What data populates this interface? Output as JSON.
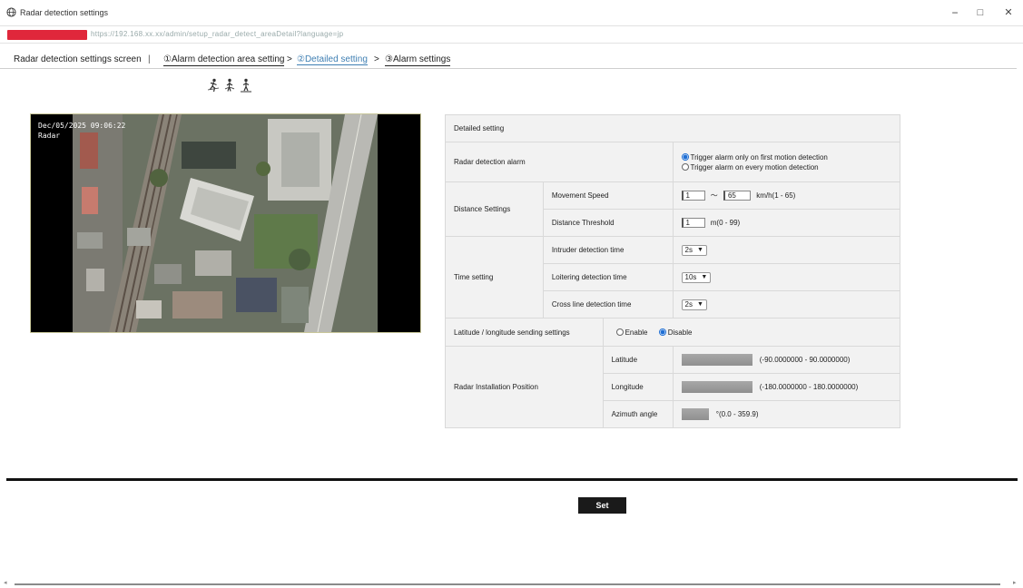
{
  "window": {
    "title": "Radar detection settings",
    "controls": {
      "minimize": "−",
      "maximize": "□",
      "close": "✕"
    }
  },
  "address": {
    "url": "https://192.168.xx.xx/admin/setup_radar_detect_areaDetail?language=jp"
  },
  "nav": {
    "screen_label": "Radar detection settings screen",
    "separator": "|",
    "step1": "①Alarm detection area setting",
    "arrow1": ">",
    "step2": "②Detailed setting",
    "arrow2": ">",
    "step3": "③Alarm settings"
  },
  "camera": {
    "datetime": "Dec/05/2025 09:06:22",
    "label": "Radar"
  },
  "detail": {
    "header": "Detailed setting",
    "radar_alarm": {
      "label": "Radar detection alarm",
      "opt1": "Trigger alarm only on first motion detection",
      "opt2": "Trigger alarm on every motion detection",
      "selected": 1
    },
    "distance": {
      "label": "Distance Settings",
      "speed_label": "Movement Speed",
      "speed_min": "1",
      "tilde": "～",
      "speed_max": "65",
      "speed_unit": "km/h(1 - 65)",
      "threshold_label": "Distance Threshold",
      "threshold": "1",
      "threshold_unit": "m(0 - 99)"
    },
    "time": {
      "label": "Time setting",
      "intruder_label": "Intruder detection time",
      "intruder": "2s",
      "loitering_label": "Loitering detection time",
      "loitering": "10s",
      "cross_label": "Cross line detection time",
      "cross": "2s"
    },
    "latlon_send": {
      "label": "Latitude / longitude sending settings",
      "enable": "Enable",
      "disable": "Disable",
      "selected": "Disable"
    },
    "position": {
      "label": "Radar Installation Position",
      "lat_label": "Latitude",
      "lat_range": "(-90.0000000 - 90.0000000)",
      "lon_label": "Longitude",
      "lon_range": "(-180.0000000 - 180.0000000)",
      "az_label": "Azimuth angle",
      "az_range": "°(0.0 - 359.9)"
    }
  },
  "buttons": {
    "set": "Set"
  },
  "colors": {
    "accent": "#3f7fb3",
    "radio": "#1e6ed4",
    "redacted": "#e0273b",
    "set_button": "#1a1a1a"
  }
}
